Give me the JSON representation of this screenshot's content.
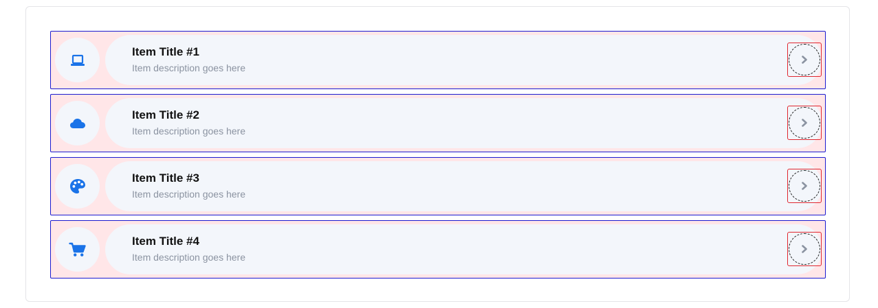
{
  "colors": {
    "accent": "#1a73e8",
    "item_border": "#1a1ad0",
    "item_bg": "#ffe6e8",
    "body_bg": "#f3f6fb",
    "description": "#8b93a1",
    "chevron": "#8b93a1",
    "chevron_border": "#e0262e"
  },
  "items": [
    {
      "icon": "laptop-icon",
      "title": "Item Title #1",
      "description": "Item description goes here"
    },
    {
      "icon": "cloud-icon",
      "title": "Item Title #2",
      "description": "Item description goes here"
    },
    {
      "icon": "palette-icon",
      "title": "Item Title #3",
      "description": "Item description goes here"
    },
    {
      "icon": "shopping-cart-icon",
      "title": "Item Title #4",
      "description": "Item description goes here"
    }
  ]
}
